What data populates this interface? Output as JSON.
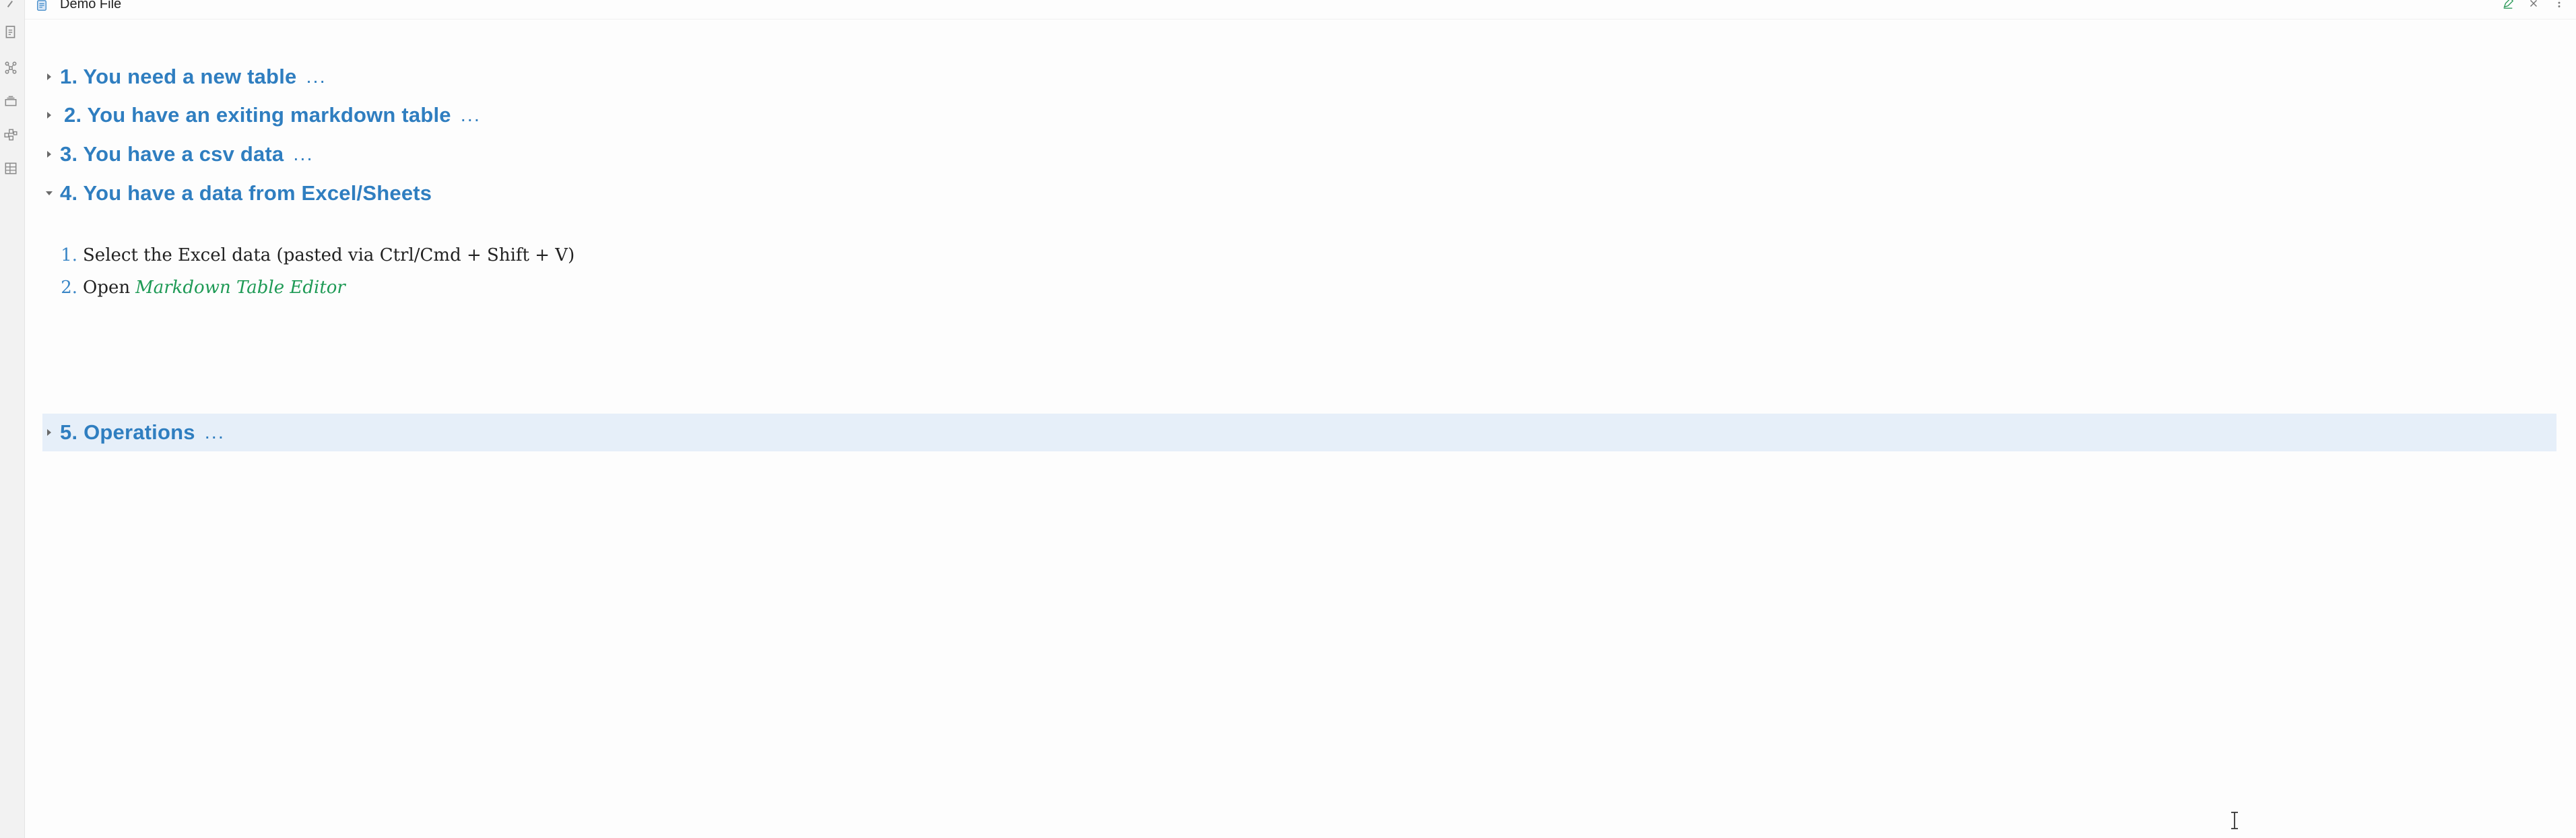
{
  "tab": {
    "title": "Demo File",
    "icon": "document-icon",
    "actions": [
      "edit-icon",
      "close-icon",
      "more-options-icon"
    ]
  },
  "ribbon": {
    "icons": [
      "file-explorer-icon",
      "graph-view-icon",
      "stacks-icon",
      "canvas-icon",
      "table-icon"
    ]
  },
  "headings": [
    {
      "label": "1. You need a new table",
      "collapsed": true,
      "ellipsis": "..."
    },
    {
      "label": "2. You have an exiting markdown table",
      "collapsed": true,
      "ellipsis": "..."
    },
    {
      "label": "3. You have a csv data",
      "collapsed": true,
      "ellipsis": "..."
    },
    {
      "label": "4. You have a data from Excel/Sheets",
      "collapsed": false
    },
    {
      "label": "5. Operations",
      "collapsed": true,
      "ellipsis": "...",
      "highlighted": true
    }
  ],
  "steps": [
    {
      "num": "1.",
      "text": "Select the Excel data (pasted via Ctrl/Cmd + Shift + V)"
    },
    {
      "num": "2.",
      "text": "Open",
      "emphasis": "Markdown Table Editor"
    }
  ],
  "colors": {
    "heading": "#2f7ec0",
    "emphasis": "#1e9a55",
    "highlight": "#e6eff9"
  }
}
